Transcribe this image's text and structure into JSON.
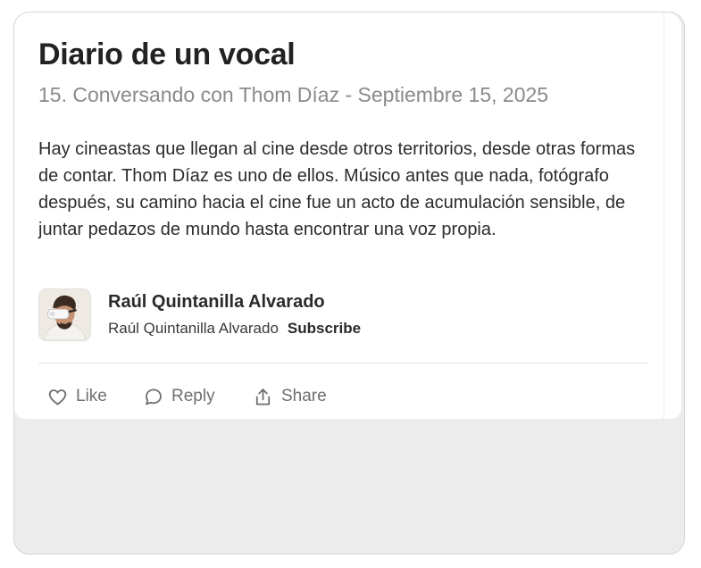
{
  "post": {
    "title": "Diario de un vocal",
    "subtitle": "15. Conversando con Thom Díaz - Septiembre 15, 2025",
    "excerpt": "Hay cineastas que llegan al cine desde otros territorios, desde otras formas de contar. Thom Díaz es uno de ellos. Músico antes que nada, fotógrafo después, su camino hacia el cine fue un acto de acumulación sensible, de juntar pedazos de mundo hasta encontrar una voz propia."
  },
  "author": {
    "name": "Raúl Quintanilla Alvarado",
    "publication": "Raúl Quintanilla Alvarado",
    "subscribe_label": "Subscribe",
    "avatar_icon": "person-vr-headset-avatar"
  },
  "actions": {
    "like_label": "Like",
    "like_icon": "heart-icon",
    "reply_label": "Reply",
    "reply_icon": "comment-bubble-icon",
    "share_label": "Share",
    "share_icon": "share-upload-icon"
  },
  "colors": {
    "title": "#222222",
    "subtitle": "#8a8a8a",
    "action_gray": "#6f6f6f",
    "frame_background": "#ececec"
  }
}
